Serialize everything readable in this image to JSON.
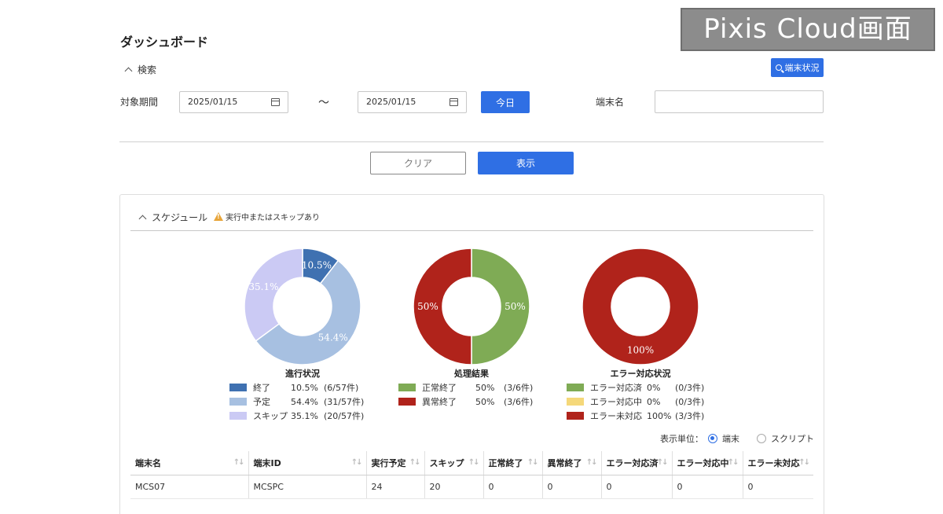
{
  "watermark": "Pixis Cloud画面",
  "page_title": "ダッシュボード",
  "search": {
    "toggle_label": "検索",
    "terminal_status_button": "端末状況",
    "period_label": "対象期間",
    "date_from": "2025/01/15",
    "tilde": "～",
    "date_to": "2025/01/15",
    "today_button": "今日",
    "terminal_name_label": "端末名",
    "terminal_name_value": "",
    "clear_button": "クリア",
    "show_button": "表示"
  },
  "schedule": {
    "toggle_label": "スケジュール",
    "warning": "実行中またはスキップあり",
    "warning_icon": "warning-icon"
  },
  "charts": [
    {
      "title": "進行状況",
      "legend": [
        {
          "label": "終了",
          "pct": "10.5%",
          "count": "(6/57件)",
          "color": "#3f71b1",
          "value": 10.5
        },
        {
          "label": "予定",
          "pct": "54.4%",
          "count": "(31/57件)",
          "color": "#a7c0e1",
          "value": 54.4
        },
        {
          "label": "スキップ",
          "pct": "35.1%",
          "count": "(20/57件)",
          "color": "#cbcaf4",
          "value": 35.1
        }
      ]
    },
    {
      "title": "処理結果",
      "legend": [
        {
          "label": "正常終了",
          "pct": "50%",
          "count": "(3/6件)",
          "color": "#7fab55",
          "value": 50
        },
        {
          "label": "異常終了",
          "pct": "50%",
          "count": "(3/6件)",
          "color": "#b0231b",
          "value": 50
        }
      ]
    },
    {
      "title": "エラー対応状況",
      "legend": [
        {
          "label": "エラー対応済",
          "pct": "0%",
          "count": "(0/3件)",
          "color": "#7fab55",
          "value": 0
        },
        {
          "label": "エラー対応中",
          "pct": "0%",
          "count": "(0/3件)",
          "color": "#f5d87a",
          "value": 0
        },
        {
          "label": "エラー未対応",
          "pct": "100%",
          "count": "(3/3件)",
          "color": "#b0231b",
          "value": 100
        }
      ]
    }
  ],
  "display_unit": {
    "label": "表示単位：",
    "options": [
      {
        "label": "端末",
        "selected": true
      },
      {
        "label": "スクリプト",
        "selected": false
      }
    ]
  },
  "table": {
    "columns": [
      "端末名",
      "端末ID",
      "実行予定",
      "スキップ",
      "正常終了",
      "異常終了",
      "エラー対応済",
      "エラー対応中",
      "エラー未対応"
    ],
    "rows": [
      [
        "MCS07",
        "MCSPC",
        "24",
        "20",
        "0",
        "0",
        "0",
        "0",
        "0"
      ]
    ]
  }
}
